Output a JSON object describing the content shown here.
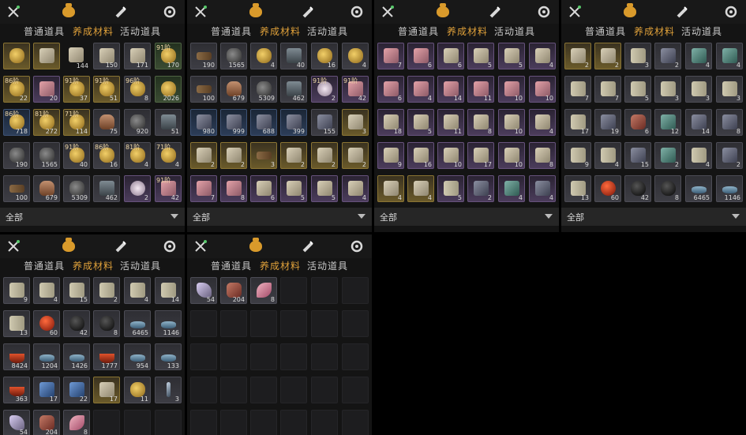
{
  "tabs": [
    "普通道具",
    "养成材料",
    "活动道具"
  ],
  "filter_label": "全部",
  "accent": "#e0a13a",
  "panels": [
    {
      "rows": [
        [
          [
            "gold",
            "gold",
            ""
          ],
          [
            "gold",
            "paper",
            ""
          ],
          [
            "paper",
            "paper",
            "144"
          ],
          [
            "grey",
            "paper",
            "150"
          ],
          [
            "grey",
            "paper",
            "171"
          ],
          [
            "green",
            "gold",
            "170"
          ]
        ],
        [
          [
            "gold",
            "gold",
            "22"
          ],
          [
            "purple",
            "pink",
            "20"
          ],
          [
            "gold",
            "gold",
            "37"
          ],
          [
            "gold",
            "gold",
            "51"
          ],
          [
            "grey",
            "gold",
            "8"
          ],
          [
            "green",
            "gold",
            "2026"
          ]
        ],
        [
          [
            "blue",
            "gold",
            "718"
          ],
          [
            "gold",
            "gold",
            "272"
          ],
          [
            "gold",
            "gold",
            "114"
          ],
          [
            "grey",
            "bottle",
            "75"
          ],
          [
            "grey",
            "rock",
            "920"
          ],
          [
            "grey",
            "box",
            "51"
          ]
        ],
        [
          [
            "grey",
            "rock",
            "190"
          ],
          [
            "grey",
            "rock",
            "1565"
          ],
          [
            "grey",
            "gold",
            "40"
          ],
          [
            "grey",
            "gold",
            "16"
          ],
          [
            "grey",
            "gold",
            "4"
          ],
          [
            "grey",
            "gold",
            "4"
          ]
        ],
        [
          [
            "grey",
            "wood",
            "100"
          ],
          [
            "grey",
            "bottle",
            "679"
          ],
          [
            "grey",
            "rock",
            "5309"
          ],
          [
            "grey",
            "box",
            "462"
          ],
          [
            "purple",
            "shell",
            "2"
          ],
          [
            "purple",
            "pink",
            "42"
          ]
        ]
      ],
      "levels": [
        [
          "",
          "",
          "",
          "",
          "",
          "91阶"
        ],
        [
          "86阶",
          "",
          "91阶",
          "91阶",
          "96阶",
          ""
        ],
        [
          "86阶",
          "81阶",
          "71阶",
          "",
          "",
          ""
        ],
        [
          "",
          "",
          "91阶",
          "86阶",
          "81阶",
          "71阶"
        ],
        [
          "",
          "",
          "",
          "",
          "",
          "91阶"
        ]
      ]
    },
    {
      "rows": [
        [
          [
            "grey",
            "wood",
            "190"
          ],
          [
            "grey",
            "rock",
            "1565"
          ],
          [
            "grey",
            "gold",
            "4"
          ],
          [
            "grey",
            "box",
            "40"
          ],
          [
            "grey",
            "gold",
            "16"
          ],
          [
            "grey",
            "gold",
            "4"
          ]
        ],
        [
          [
            "grey",
            "wood",
            "100"
          ],
          [
            "grey",
            "bottle",
            "679"
          ],
          [
            "grey",
            "rock",
            "5309"
          ],
          [
            "grey",
            "box",
            "462"
          ],
          [
            "purple",
            "shell",
            "2"
          ],
          [
            "purple",
            "pink",
            "42"
          ]
        ],
        [
          [
            "blue",
            "slate",
            "980"
          ],
          [
            "blue",
            "slate",
            "999"
          ],
          [
            "blue",
            "slate",
            "688"
          ],
          [
            "blue",
            "slate",
            "399"
          ],
          [
            "grey",
            "slate",
            "155"
          ],
          [
            "gold",
            "paper",
            "3"
          ]
        ],
        [
          [
            "gold",
            "paper",
            "2"
          ],
          [
            "gold",
            "paper",
            "2"
          ],
          [
            "gold",
            "wood",
            "3"
          ],
          [
            "gold",
            "paper",
            "2"
          ],
          [
            "gold",
            "paper",
            "2"
          ],
          [
            "gold",
            "paper",
            "2"
          ]
        ],
        [
          [
            "purple",
            "pink",
            "7"
          ],
          [
            "purple",
            "pink",
            "8"
          ],
          [
            "purple",
            "paper",
            "6"
          ],
          [
            "purple",
            "paper",
            "5"
          ],
          [
            "purple",
            "paper",
            "5"
          ],
          [
            "purple",
            "paper",
            "4"
          ]
        ]
      ],
      "levels": [
        [
          "",
          "",
          "",
          "",
          "",
          ""
        ],
        [
          "",
          "",
          "",
          "",
          "91阶",
          "91阶"
        ],
        [
          "",
          "",
          "",
          "",
          "",
          ""
        ],
        [
          "",
          "",
          "",
          "",
          "",
          ""
        ],
        [
          "",
          "",
          "",
          "",
          "",
          ""
        ]
      ]
    },
    {
      "rows": [
        [
          [
            "purple",
            "pink",
            "7"
          ],
          [
            "purple",
            "pink",
            "6"
          ],
          [
            "purple",
            "paper",
            "6"
          ],
          [
            "purple",
            "paper",
            "5"
          ],
          [
            "purple",
            "paper",
            "5"
          ],
          [
            "purple",
            "paper",
            "4"
          ]
        ],
        [
          [
            "purple",
            "pink",
            "6"
          ],
          [
            "purple",
            "pink",
            "4"
          ],
          [
            "purple",
            "pink",
            "14"
          ],
          [
            "purple",
            "pink",
            "11"
          ],
          [
            "purple",
            "pink",
            "10"
          ],
          [
            "purple",
            "pink",
            "10"
          ]
        ],
        [
          [
            "purple",
            "paper",
            "18"
          ],
          [
            "purple",
            "paper",
            "5"
          ],
          [
            "purple",
            "paper",
            "11"
          ],
          [
            "purple",
            "paper",
            "8"
          ],
          [
            "purple",
            "paper",
            "10"
          ],
          [
            "purple",
            "paper",
            "4"
          ]
        ],
        [
          [
            "purple",
            "paper",
            "9"
          ],
          [
            "purple",
            "paper",
            "16"
          ],
          [
            "purple",
            "paper",
            "10"
          ],
          [
            "purple",
            "paper",
            "17"
          ],
          [
            "purple",
            "paper",
            "10"
          ],
          [
            "purple",
            "paper",
            "8"
          ]
        ],
        [
          [
            "gold",
            "paper",
            "4"
          ],
          [
            "gold",
            "paper",
            "4"
          ],
          [
            "purple",
            "book",
            "5"
          ],
          [
            "purple",
            "slate",
            "2"
          ],
          [
            "purple",
            "teal",
            "4"
          ],
          [
            "purple",
            "slate",
            "4"
          ]
        ]
      ],
      "levels": [
        [
          "",
          "",
          "",
          "",
          "",
          ""
        ],
        [
          "",
          "",
          "",
          "",
          "",
          ""
        ],
        [
          "",
          "",
          "",
          "",
          "",
          ""
        ],
        [
          "",
          "",
          "",
          "",
          "",
          ""
        ],
        [
          "",
          "",
          "",
          "",
          "",
          ""
        ]
      ]
    },
    {
      "rows": [
        [
          [
            "gold",
            "paper",
            "2"
          ],
          [
            "gold",
            "paper",
            "2"
          ],
          [
            "grey",
            "book",
            "3"
          ],
          [
            "grey",
            "slate",
            "2"
          ],
          [
            "grey",
            "teal",
            "4"
          ],
          [
            "grey",
            "teal",
            "4"
          ]
        ],
        [
          [
            "grey",
            "book",
            "7"
          ],
          [
            "grey",
            "book",
            "7"
          ],
          [
            "grey",
            "book",
            "5"
          ],
          [
            "grey",
            "book",
            "3"
          ],
          [
            "grey",
            "book",
            "3"
          ],
          [
            "grey",
            "book",
            "3"
          ]
        ],
        [
          [
            "grey",
            "book",
            "17"
          ],
          [
            "grey",
            "slate",
            "19"
          ],
          [
            "grey",
            "herb",
            "6"
          ],
          [
            "grey",
            "teal",
            "12"
          ],
          [
            "grey",
            "slate",
            "14"
          ],
          [
            "grey",
            "slate",
            "8"
          ]
        ],
        [
          [
            "grey",
            "book",
            "9"
          ],
          [
            "grey",
            "book",
            "4"
          ],
          [
            "grey",
            "slate",
            "15"
          ],
          [
            "grey",
            "teal",
            "2"
          ],
          [
            "grey",
            "book",
            "4"
          ],
          [
            "grey",
            "slate",
            "2"
          ]
        ],
        [
          [
            "grey",
            "book",
            "13"
          ],
          [
            "grey",
            "red",
            "60"
          ],
          [
            "grey",
            "ink",
            "42"
          ],
          [
            "grey",
            "ink",
            "8"
          ],
          [
            "grey",
            "boat",
            "6465"
          ],
          [
            "grey",
            "boat",
            "1146"
          ]
        ]
      ],
      "levels": [
        [
          "",
          "",
          "",
          "",
          "",
          ""
        ],
        [
          "",
          "",
          "",
          "",
          "",
          ""
        ],
        [
          "",
          "",
          "",
          "",
          "",
          ""
        ],
        [
          "",
          "",
          "",
          "",
          "",
          ""
        ],
        [
          "",
          "",
          "",
          "",
          "",
          ""
        ]
      ]
    },
    {
      "rows": [
        [
          [
            "grey",
            "book",
            "9"
          ],
          [
            "grey",
            "book",
            "4"
          ],
          [
            "grey",
            "book",
            "15"
          ],
          [
            "grey",
            "book",
            "2"
          ],
          [
            "grey",
            "book",
            "4"
          ],
          [
            "grey",
            "book",
            "14"
          ]
        ],
        [
          [
            "grey",
            "book",
            "13"
          ],
          [
            "grey",
            "red",
            "60"
          ],
          [
            "grey",
            "ink",
            "42"
          ],
          [
            "grey",
            "ink",
            "8"
          ],
          [
            "grey",
            "boat",
            "6465"
          ],
          [
            "grey",
            "boat",
            "1146"
          ]
        ],
        [
          [
            "grey",
            "bowl",
            "8424"
          ],
          [
            "grey",
            "boat",
            "1204"
          ],
          [
            "grey",
            "boat",
            "1426"
          ],
          [
            "grey",
            "bowl",
            "1777"
          ],
          [
            "grey",
            "boat",
            "954"
          ],
          [
            "grey",
            "boat",
            "133"
          ]
        ],
        [
          [
            "grey",
            "bowl",
            "363"
          ],
          [
            "grey",
            "blue",
            "17"
          ],
          [
            "grey",
            "blue",
            "22"
          ],
          [
            "gold",
            "paper",
            "17"
          ],
          [
            "grey",
            "gold",
            "11"
          ],
          [
            "grey",
            "staff",
            "3"
          ]
        ],
        [
          [
            "grey",
            "grass",
            "54"
          ],
          [
            "grey",
            "herb",
            "204"
          ],
          [
            "grey",
            "feather",
            "8"
          ],
          [
            "empty",
            "",
            ""
          ],
          [
            "empty",
            "",
            ""
          ],
          [
            "empty",
            "",
            ""
          ]
        ]
      ],
      "levels": [
        [
          "",
          "",
          "",
          "",
          "",
          ""
        ],
        [
          "",
          "",
          "",
          "",
          "",
          ""
        ],
        [
          "",
          "",
          "",
          "",
          "",
          ""
        ],
        [
          "",
          "",
          "",
          "",
          "",
          ""
        ],
        [
          "",
          "",
          "",
          "",
          "",
          ""
        ]
      ]
    },
    {
      "rows": [
        [
          [
            "grey",
            "grass",
            "54"
          ],
          [
            "grey",
            "herb",
            "204"
          ],
          [
            "grey",
            "feather",
            "8"
          ],
          [
            "empty",
            "",
            ""
          ],
          [
            "empty",
            "",
            ""
          ],
          [
            "empty",
            "",
            ""
          ]
        ],
        [
          [
            "empty",
            "",
            ""
          ],
          [
            "empty",
            "",
            ""
          ],
          [
            "empty",
            "",
            ""
          ],
          [
            "empty",
            "",
            ""
          ],
          [
            "empty",
            "",
            ""
          ],
          [
            "empty",
            "",
            ""
          ]
        ],
        [
          [
            "empty",
            "",
            ""
          ],
          [
            "empty",
            "",
            ""
          ],
          [
            "empty",
            "",
            ""
          ],
          [
            "empty",
            "",
            ""
          ],
          [
            "empty",
            "",
            ""
          ],
          [
            "empty",
            "",
            ""
          ]
        ],
        [
          [
            "empty",
            "",
            ""
          ],
          [
            "empty",
            "",
            ""
          ],
          [
            "empty",
            "",
            ""
          ],
          [
            "empty",
            "",
            ""
          ],
          [
            "empty",
            "",
            ""
          ],
          [
            "empty",
            "",
            ""
          ]
        ],
        [
          [
            "empty",
            "",
            ""
          ],
          [
            "empty",
            "",
            ""
          ],
          [
            "empty",
            "",
            ""
          ],
          [
            "empty",
            "",
            ""
          ],
          [
            "empty",
            "",
            ""
          ],
          [
            "empty",
            "",
            ""
          ]
        ]
      ],
      "levels": [
        [
          "",
          "",
          "",
          "",
          "",
          ""
        ],
        [
          "",
          "",
          "",
          "",
          "",
          ""
        ],
        [
          "",
          "",
          "",
          "",
          "",
          ""
        ],
        [
          "",
          "",
          "",
          "",
          "",
          ""
        ],
        [
          "",
          "",
          "",
          "",
          "",
          ""
        ]
      ]
    }
  ]
}
